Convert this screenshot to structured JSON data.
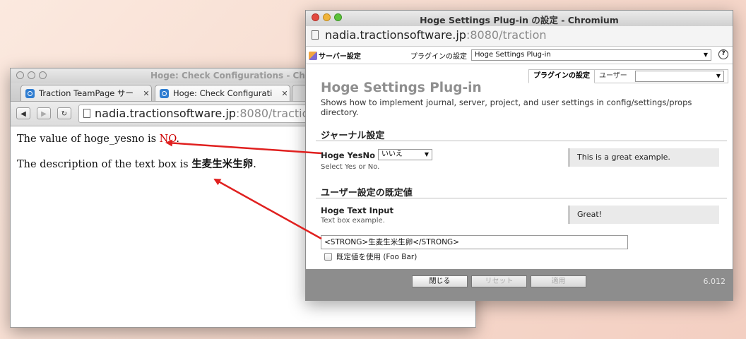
{
  "back_window": {
    "title": "Hoge: Check Configurations - Chro",
    "tabs": [
      {
        "label": "Traction TeamPage サー",
        "close": "✕"
      },
      {
        "label": "Hoge: Check Configurati",
        "close": "✕"
      }
    ],
    "url_host": "nadia.tractionsoftware.jp",
    "url_rest": ":8080/traction",
    "content": {
      "line1_prefix": "The value of hoge_yesno is ",
      "line1_value": "NO",
      "line1_suffix": ".",
      "line2_prefix": "The description of the text box is ",
      "line2_value": "生麦生米生卵",
      "line2_suffix": "."
    }
  },
  "front_window": {
    "title": "Hoge Settings Plug-in の設定 - Chromium",
    "url_host": "nadia.tractionsoftware.jp",
    "url_rest": ":8080/traction",
    "toolbar": {
      "server_settings": "サーバー設定",
      "plugin_label": "プラグインの設定",
      "plugin_select": "Hoge Settings Plug-in",
      "help": "?"
    },
    "subtabs": {
      "plugin_settings": "プラグインの設定",
      "user": "ユーザー"
    },
    "page_title": "Hoge Settings Plug-in",
    "page_desc": "Shows how to implement journal, server, project, and user settings in config/settings/props directory.",
    "section1": {
      "heading": "ジャーナル設定",
      "field_label": "Hoge YesNo",
      "field_select": "いいえ",
      "field_help": "Select Yes or No.",
      "note": "This is a great example."
    },
    "section2": {
      "heading": "ユーザー設定の既定値",
      "field_label": "Hoge Text Input",
      "field_help": "Text box example.",
      "note": "Great!",
      "input_value": "<STRONG>生麦生米生卵</STRONG>",
      "checkbox_label": "既定値を使用 (Foo Bar)"
    },
    "footer": {
      "close": "閉じる",
      "reset": "リセット",
      "apply": "適用",
      "version": "6.012"
    }
  },
  "colors": {
    "arrow": "#e0201f",
    "no_value": "#cc0000"
  }
}
